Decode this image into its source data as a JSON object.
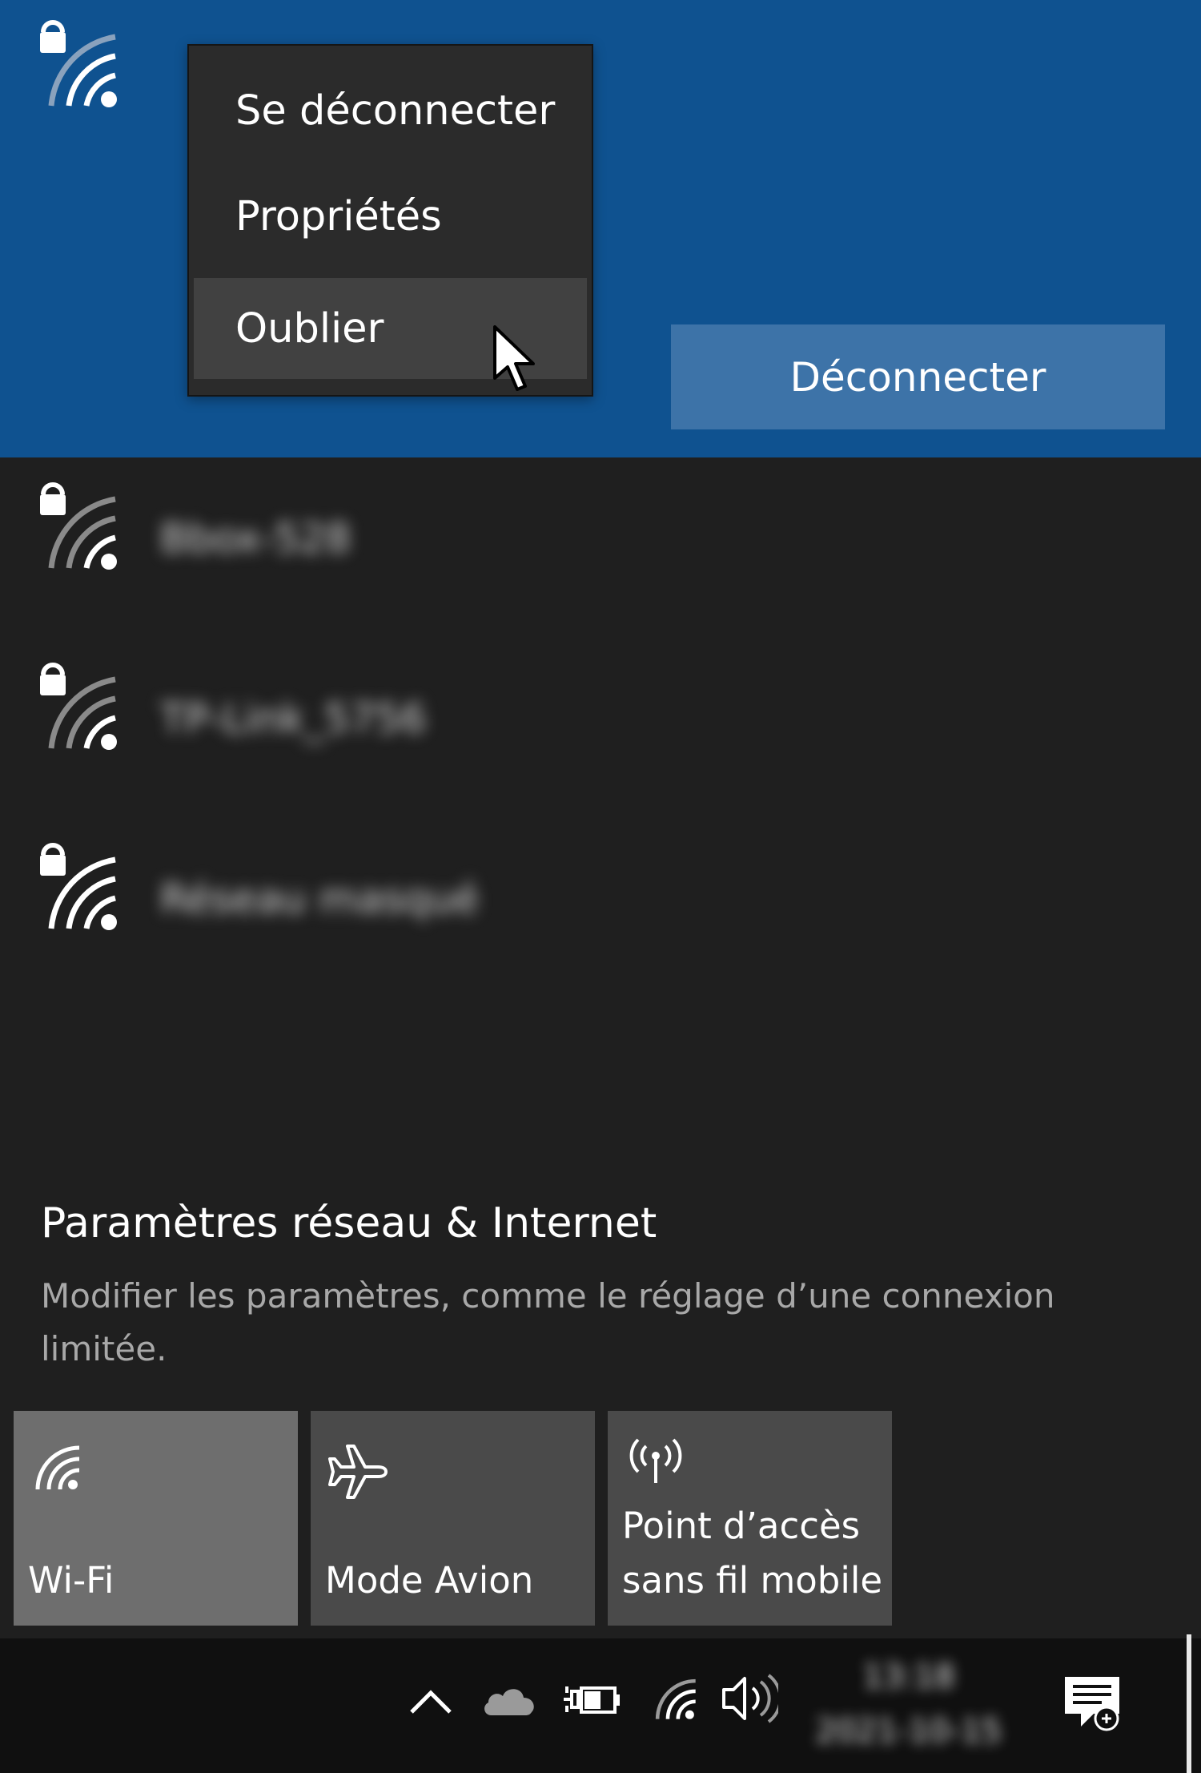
{
  "context_menu": {
    "items": [
      {
        "label": "Se déconnecter"
      },
      {
        "label": "Propriétés"
      },
      {
        "label": "Oublier"
      }
    ]
  },
  "connected_network": {
    "disconnect_label": "Déconnecter"
  },
  "networks": [
    {
      "name": "Bbox-528"
    },
    {
      "name": "TP-Link_5756"
    },
    {
      "name": "Réseau masqué"
    }
  ],
  "settings": {
    "title": "Paramètres réseau & Internet",
    "description": "Modifier les paramètres, comme le réglage d’une connexion limitée."
  },
  "quick_actions": [
    {
      "label": "Wi-Fi",
      "icon": "wifi-icon",
      "active": true
    },
    {
      "label": "Mode Avion",
      "icon": "airplane-icon",
      "active": false
    },
    {
      "label": "Point d’accès sans fil mobile",
      "icon": "mobile-hotspot-icon",
      "active": false
    }
  ],
  "taskbar": {
    "time": "13:18",
    "date": "2021-10-15",
    "icons": [
      "chevron-up-icon",
      "onedrive-icon",
      "battery-plug-icon",
      "wifi-icon",
      "volume-icon",
      "notifications-icon"
    ]
  },
  "colors": {
    "connected_bg": "#0f5290",
    "disconnect_button": "#3d73a8",
    "panel_bg": "#1f1f1f",
    "menu_bg": "#2b2b2b",
    "tile_active": "#6e6e6e",
    "tile_inactive": "#4a4a4a",
    "taskbar_bg": "#101010"
  }
}
